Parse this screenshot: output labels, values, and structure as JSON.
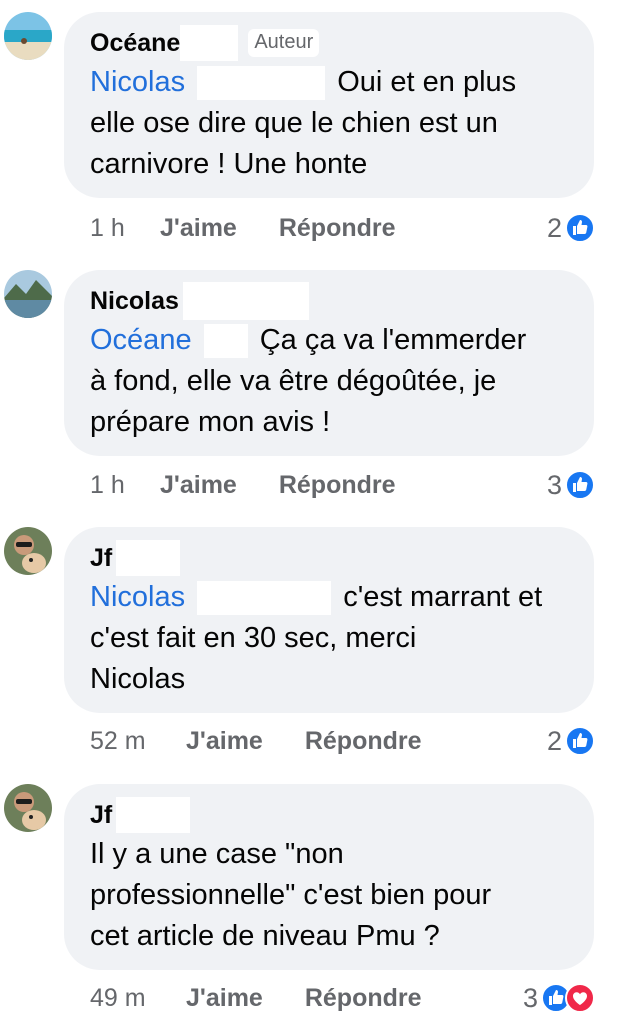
{
  "colors": {
    "mention": "#216fdb",
    "bubble": "#f0f2f5",
    "meta": "#65676b",
    "like": "#1877f2",
    "love": "#f02849"
  },
  "comments": [
    {
      "author": "Océane",
      "badge": "Auteur",
      "mention": "Nicolas",
      "line1_rest": "Oui et en plus",
      "lines": [
        "elle ose dire que le chien est un",
        "carnivore ! Une honte"
      ],
      "time": "1 h",
      "like": "J'aime",
      "reply": "Répondre",
      "count": "2",
      "reactions": [
        "like-icon"
      ]
    },
    {
      "author": "Nicolas",
      "mention": "Océane",
      "line1_rest": "Ça ça va l'emmerder",
      "lines": [
        "à fond, elle va être dégoûtée, je",
        "prépare mon avis !"
      ],
      "time": "1 h",
      "like": "J'aime",
      "reply": "Répondre",
      "count": "3",
      "reactions": [
        "like-icon"
      ]
    },
    {
      "author": "Jf",
      "mention": "Nicolas",
      "line1_rest": "c'est marrant et",
      "lines": [
        "c'est  fait en 30 sec, merci",
        "Nicolas"
      ],
      "time": "52 m",
      "like": "J'aime",
      "reply": "Répondre",
      "count": "2",
      "reactions": [
        "like-icon"
      ]
    },
    {
      "author": "Jf",
      "lines": [
        "Il y a une case \"non",
        "professionnelle\" c'est bien pour",
        "cet article de niveau Pmu ?"
      ],
      "time": "49 m",
      "like": "J'aime",
      "reply": "Répondre",
      "count": "3",
      "reactions": [
        "like-icon",
        "love-icon"
      ]
    }
  ]
}
